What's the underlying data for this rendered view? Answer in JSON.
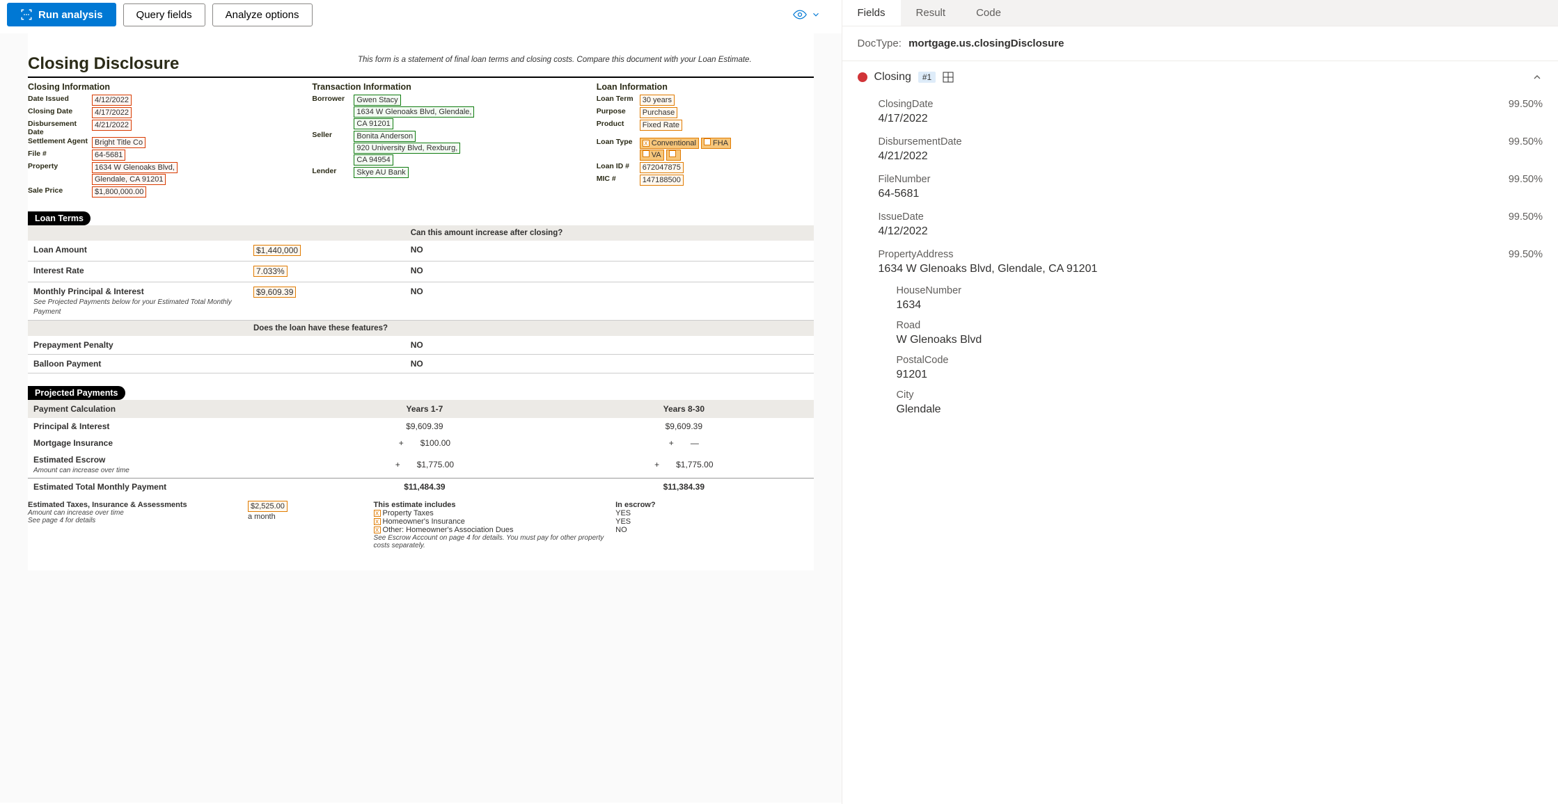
{
  "toolbar": {
    "run": "Run analysis",
    "query": "Query fields",
    "analyze": "Analyze options"
  },
  "document": {
    "title": "Closing Disclosure",
    "note": "This form is a statement of final loan terms and closing costs. Compare this document with your Loan Estimate.",
    "closing_info_h": "Closing  Information",
    "transaction_info_h": "Transaction  Information",
    "loan_info_h": "Loan  Information",
    "closing": {
      "date_issued_l": "Date Issued",
      "date_issued": "4/12/2022",
      "closing_date_l": "Closing Date",
      "closing_date": "4/17/2022",
      "disb_date_l": "Disbursement Date",
      "disb_date": "4/21/2022",
      "settlement_l": "Settlement Agent",
      "settlement": "Bright Title Co",
      "file_l": "File #",
      "file": "64-5681",
      "property_l": "Property",
      "property1": "1634 W Glenoaks Blvd,",
      "property2": "Glendale, CA 91201",
      "sale_l": "Sale Price",
      "sale": "$1,800,000.00"
    },
    "trans": {
      "borrower_l": "Borrower",
      "borrower1": "Gwen Stacy",
      "borrower2": "1634 W Glenoaks Blvd, Glendale,",
      "borrower3": "CA 91201",
      "seller_l": "Seller",
      "seller1": "Bonita Anderson",
      "seller2": "920 University Blvd, Rexburg,",
      "seller3": "CA 94954",
      "lender_l": "Lender",
      "lender": "Skye AU Bank"
    },
    "loan": {
      "term_l": "Loan Term",
      "term": "30 years",
      "purpose_l": "Purpose",
      "purpose": "Purchase",
      "product_l": "Product",
      "product": "Fixed Rate",
      "type_l": "Loan Type",
      "type1": "Conventional",
      "type2": "FHA",
      "type3": "VA",
      "id_l": "Loan ID #",
      "id": "672047875",
      "mic_l": "MIC #",
      "mic": "147188500"
    },
    "section_terms": "Loan Terms",
    "terms_q": "Can this amount increase after closing?",
    "terms": {
      "amount_l": "Loan Amount",
      "amount": "$1,440,000",
      "amount_a": "NO",
      "rate_l": "Interest Rate",
      "rate": "7.033%",
      "rate_a": "NO",
      "mpi_l": "Monthly Principal & Interest",
      "mpi": "$9,609.39",
      "mpi_a": "NO",
      "mpi_note": "See Projected Payments below for your Estimated Total Monthly Payment",
      "feat_q": "Does the loan have these features?",
      "prepay_l": "Prepayment Penalty",
      "prepay_a": "NO",
      "balloon_l": "Balloon Payment",
      "balloon_a": "NO"
    },
    "section_proj": "Projected Payments",
    "proj": {
      "calc_h": "Payment Calculation",
      "y1": "Years 1-7",
      "y8": "Years 8-30",
      "pi_l": "Principal & Interest",
      "pi1": "$9,609.39",
      "pi8": "$9,609.39",
      "mi_l": "Mortgage Insurance",
      "mi1": "$100.00",
      "mi8": "—",
      "ee_l": "Estimated Escrow",
      "ee_note": "Amount can increase over time",
      "ee1": "$1,775.00",
      "ee8": "$1,775.00",
      "et_l": "Estimated Total Monthly Payment",
      "et1": "$11,484.39",
      "et8": "$11,384.39"
    },
    "escrow": {
      "taxes_l": "Estimated Taxes, Insurance & Assessments",
      "taxes_v": "$2,525.00",
      "taxes_per": "a month",
      "note1": "Amount can increase over time",
      "note2": "See page 4 for details",
      "includes_h": "This estimate includes",
      "inescrow_h": "In escrow?",
      "i1": "Property Taxes",
      "e1": "YES",
      "i2": "Homeowner's Insurance",
      "e2": "YES",
      "i3": "Other: Homeowner's Association Dues",
      "e3": "NO",
      "foot": "See Escrow Account on page 4 for details. You must pay for other property costs separately."
    }
  },
  "panel": {
    "tabs": {
      "fields": "Fields",
      "result": "Result",
      "code": "Code"
    },
    "doctype_k": "DocType:",
    "doctype_v": "mortgage.us.closingDisclosure",
    "group": "Closing",
    "badge": "#1",
    "fields": [
      {
        "k": "ClosingDate",
        "v": "4/17/2022",
        "pc": "99.50%"
      },
      {
        "k": "DisbursementDate",
        "v": "4/21/2022",
        "pc": "99.50%"
      },
      {
        "k": "FileNumber",
        "v": "64-5681",
        "pc": "99.50%"
      },
      {
        "k": "IssueDate",
        "v": "4/12/2022",
        "pc": "99.50%"
      },
      {
        "k": "PropertyAddress",
        "v": "1634 W Glenoaks Blvd, Glendale, CA 91201",
        "pc": "99.50%"
      }
    ],
    "subfields": [
      {
        "k": "HouseNumber",
        "v": "1634"
      },
      {
        "k": "Road",
        "v": "W Glenoaks Blvd"
      },
      {
        "k": "PostalCode",
        "v": "91201"
      },
      {
        "k": "City",
        "v": "Glendale"
      }
    ]
  }
}
